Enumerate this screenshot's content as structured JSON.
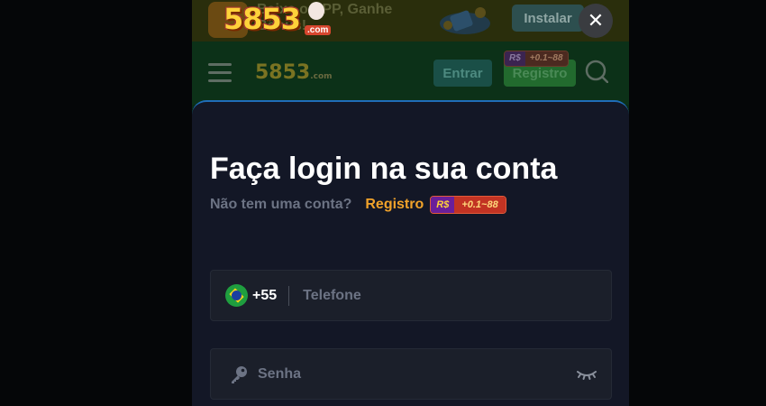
{
  "banner": {
    "text": "Baixe o APP, Ganhe Bônus!",
    "install_label": "Instalar",
    "logo_text": "5853",
    "logo_suffix": ".com"
  },
  "header": {
    "logo_text": "5853",
    "logo_suffix": ".com",
    "login_label": "Entrar",
    "register_label": "Registro",
    "badge_currency": "R$",
    "badge_bonus": "+0.1~88"
  },
  "login": {
    "title": "Faça login na sua conta",
    "no_account_text": "Não tem uma conta?",
    "register_link": "Registro",
    "badge_currency": "R$",
    "badge_bonus": "+0.1~88",
    "country_code": "+55",
    "phone_placeholder": "Telefone",
    "password_placeholder": "Senha"
  },
  "close_label": "✕",
  "icons": [
    "menu-icon",
    "search-icon",
    "close-icon",
    "brazil-flag-icon",
    "key-icon",
    "eye-closed-icon"
  ]
}
